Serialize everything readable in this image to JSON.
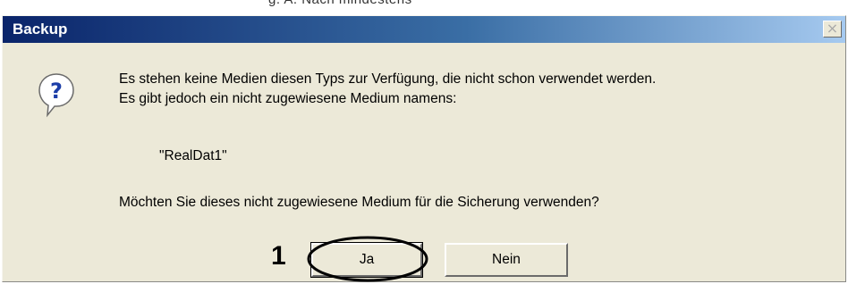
{
  "background": {
    "cut_off_text": "g. A. Nach mindestens"
  },
  "dialog": {
    "title": "Backup",
    "close_label": "×",
    "icon": "question-icon",
    "message_lines": [
      "Es stehen keine Medien diesen Typs zur Verfügung, die nicht schon verwendet werden.",
      "Es gibt jedoch ein nicht zugewiesene Medium namens:"
    ],
    "medium_name": "\"RealDat1\"",
    "question": "Möchten Sie dieses nicht zugewiesene Medium für die Sicherung verwenden?",
    "buttons": {
      "yes": "Ja",
      "no": "Nein"
    }
  },
  "annotation": {
    "number": "1"
  },
  "colors": {
    "titlebar_start": "#0a246a",
    "titlebar_end": "#a6caf0",
    "dialog_bg": "#ece9d8",
    "icon_blue": "#1c3ea8"
  }
}
